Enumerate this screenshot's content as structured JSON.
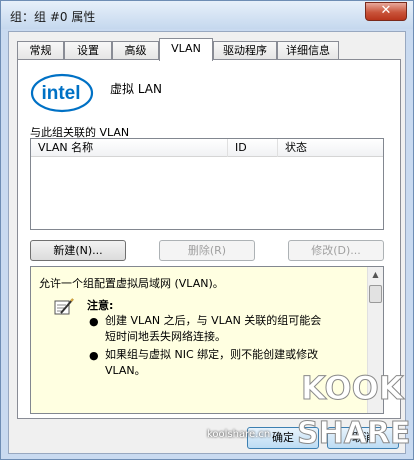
{
  "window": {
    "title": "组：组 #0 属性",
    "close_glyph": "✕"
  },
  "tabs": [
    {
      "label": "常规"
    },
    {
      "label": "设置"
    },
    {
      "label": "高级"
    },
    {
      "label": "VLAN"
    },
    {
      "label": "驱动程序"
    },
    {
      "label": "详细信息"
    }
  ],
  "active_tab": "VLAN",
  "vlan_page": {
    "logo_icon": "intel-logo",
    "logo_brand": "intel",
    "logo_caption": "虚拟 LAN",
    "list_label": "与此组关联的 VLAN",
    "columns": [
      "VLAN 名称",
      "ID",
      "状态"
    ],
    "rows": [],
    "buttons": {
      "new": "新建(N)...",
      "delete": "删除(R)",
      "modify": "修改(D)..."
    },
    "description": {
      "main": "允许一个组配置虚拟局域网 (VLAN)。",
      "note_icon": "note-pencil-icon",
      "note_title": "注意:",
      "bullets": [
        "创建 VLAN 之后，与 VLAN 关联的组可能会短时间地丢失网络连接。",
        "如果组与虚拟 NIC 绑定，则不能创建或修改 VLAN。"
      ]
    }
  },
  "footer": {
    "ok_label": "确定",
    "cancel_label": "取消"
  },
  "watermark": {
    "line1": "KOOK",
    "line2": "SHARE",
    "url": "koolshare.cn"
  },
  "colors": {
    "title_bg": "#c5d8ee",
    "close_red": "#c9543b",
    "info_bg": "#ffffe1",
    "intel_blue": "#0071c5"
  }
}
